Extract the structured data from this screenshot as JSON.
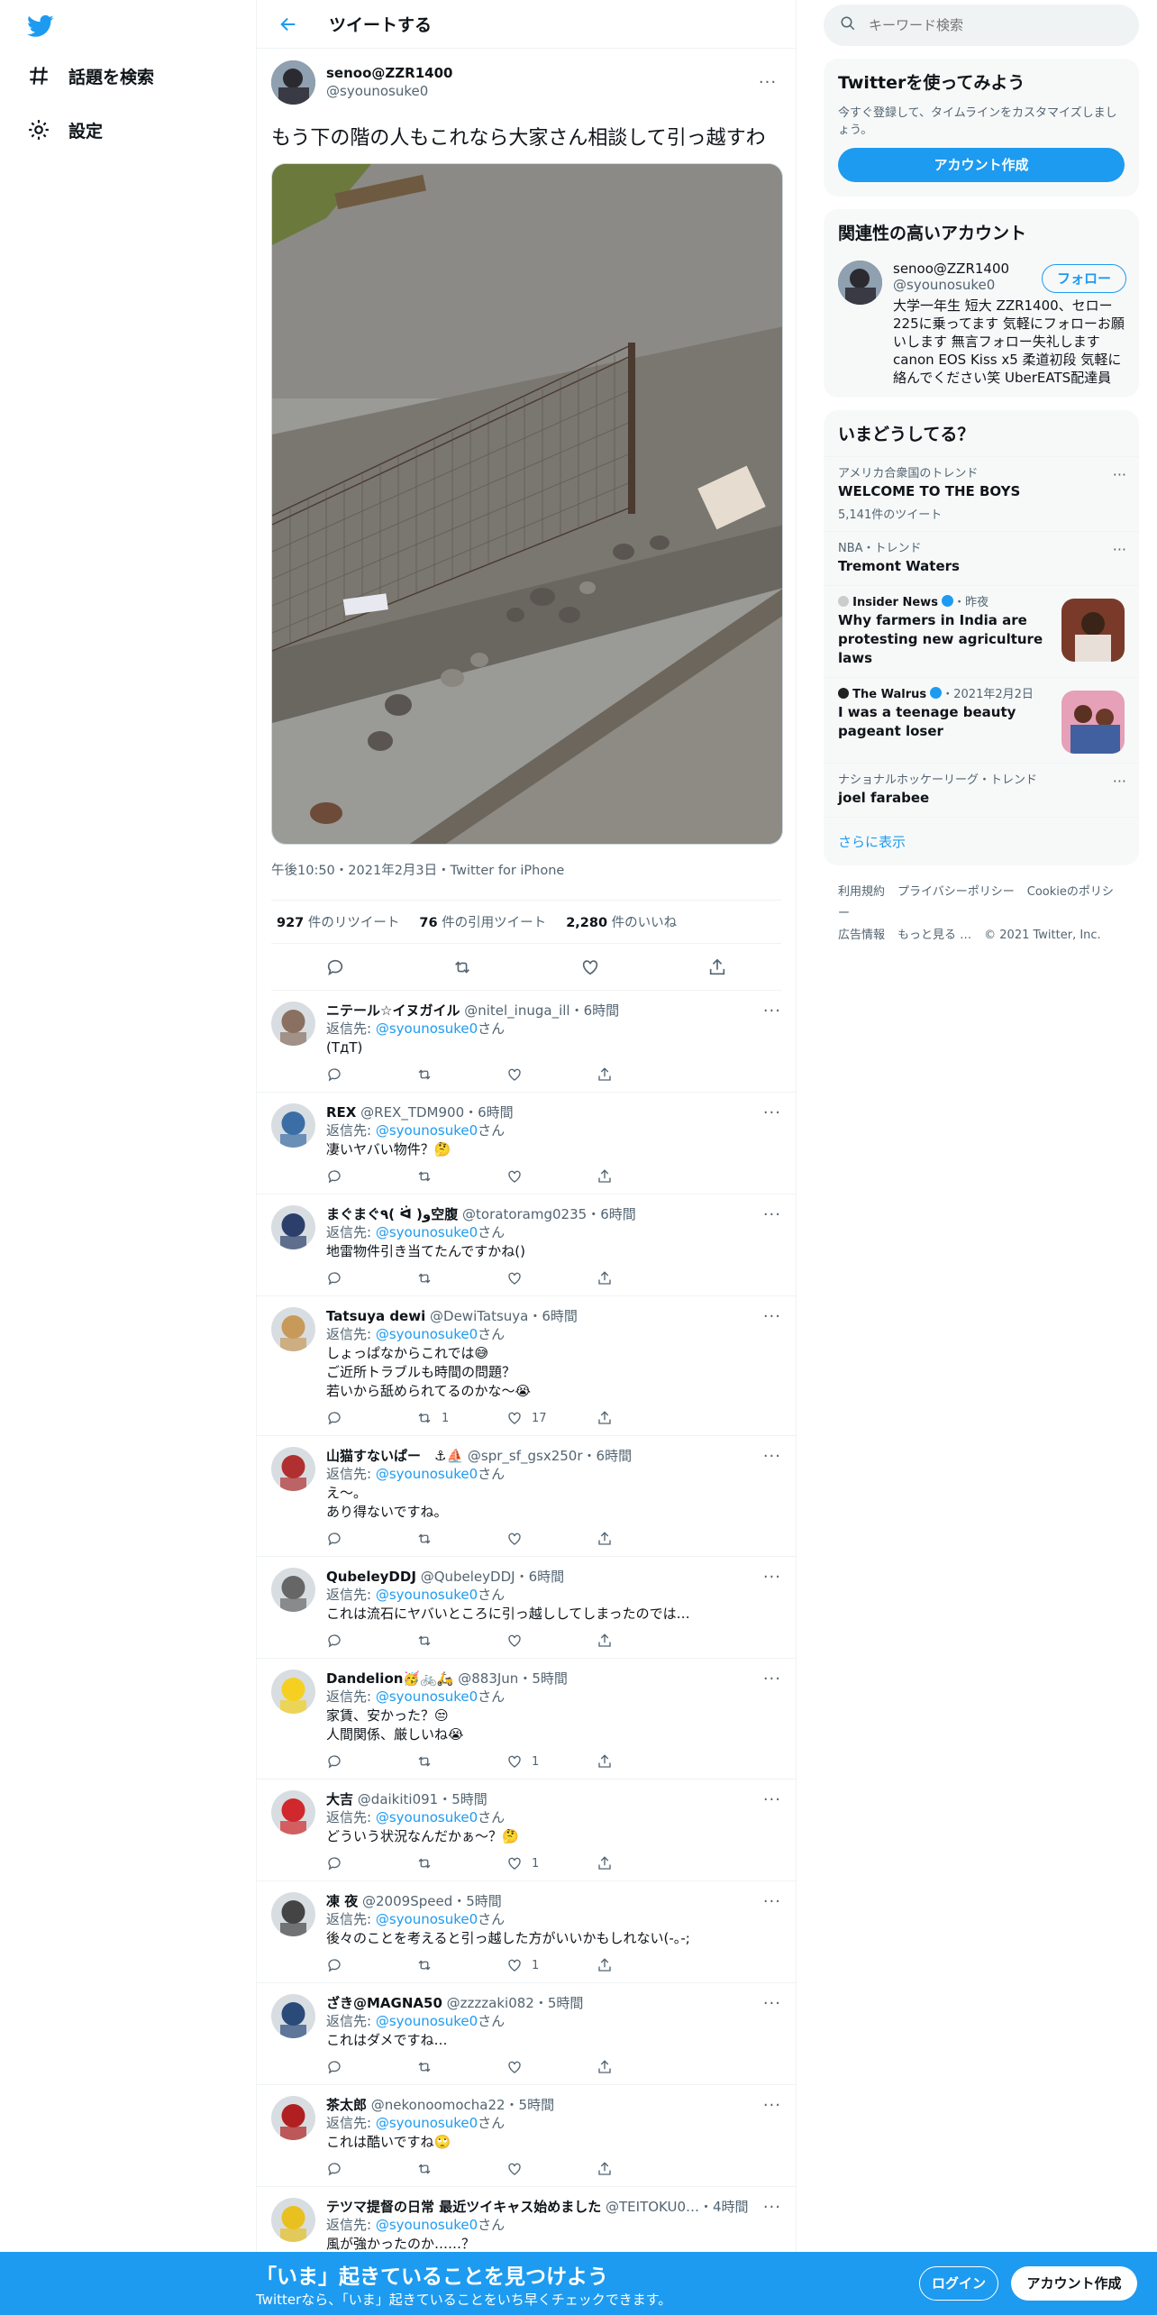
{
  "nav": {
    "explore": "話題を検索",
    "settings": "設定"
  },
  "header": {
    "title": "ツイートする"
  },
  "tweet": {
    "name": "senoo@ZZR1400",
    "handle": "@syounosuke0",
    "text": "もう下の階の人もこれなら大家さん相談して引っ越すわ",
    "meta": "午後10:50・2021年2月3日・Twitter for iPhone",
    "retweets": "927",
    "retweets_label": "件のリツイート",
    "quotes": "76",
    "quotes_label": "件の引用ツイート",
    "likes": "2,280",
    "likes_label": "件のいいね"
  },
  "replies": [
    {
      "name": "ニテール☆イヌガイル",
      "handle": "@nitel_inuga_ill",
      "time": "・6時間",
      "to_label": "返信先: ",
      "to_link": "@syounosuke0",
      "to_suffix": "さん",
      "text": "(TдT)",
      "rt": "",
      "like": "",
      "avatar": "#8a7060"
    },
    {
      "name": "REX",
      "handle": "@REX_TDM900",
      "time": "・6時間",
      "to_label": "返信先: ",
      "to_link": "@syounosuke0",
      "to_suffix": "さん",
      "text": "凄いヤバい物件？🤔",
      "rt": "",
      "like": "",
      "avatar": "#3b6ea5"
    },
    {
      "name": "まぐまぐ٩( ᐛ )و空腹",
      "handle": "@toratoramg0235",
      "time": "・6時間",
      "to_label": "返信先: ",
      "to_link": "@syounosuke0",
      "to_suffix": "さん",
      "text": "地雷物件引き当てたんですかね()",
      "rt": "",
      "like": "",
      "avatar": "#2c3f6a"
    },
    {
      "name": "Tatsuya dewi",
      "handle": "@DewiTatsuya",
      "time": "・6時間",
      "to_label": "返信先: ",
      "to_link": "@syounosuke0",
      "to_suffix": "さん",
      "text": "しょっぱなからこれでは😅\nご近所トラブルも時間の問題？\n若いから舐められてるのかな〜😭",
      "rt": "1",
      "like": "17",
      "avatar": "#c89a5a"
    },
    {
      "name": "山猫すないぱー　⚓⛵",
      "handle": "@spr_sf_gsx250r",
      "time": "・6時間",
      "to_label": "返信先: ",
      "to_link": "@syounosuke0",
      "to_suffix": "さん",
      "text": "え～。\nあり得ないですね。",
      "rt": "",
      "like": "",
      "avatar": "#b03030"
    },
    {
      "name": "QubeleyDDJ",
      "handle": "@QubeleyDDJ",
      "time": "・6時間",
      "to_label": "返信先: ",
      "to_link": "@syounosuke0",
      "to_suffix": "さん",
      "text": "これは流石にヤバいところに引っ越ししてしまったのでは…",
      "rt": "",
      "like": "",
      "avatar": "#666666"
    },
    {
      "name": "Dandelion🥳🚲🛵",
      "handle": "@883Jun",
      "time": "・5時間",
      "to_label": "返信先: ",
      "to_link": "@syounosuke0",
      "to_suffix": "さん",
      "text": "家賃、安かった？😒\n人間関係、厳しいね😭",
      "rt": "",
      "like": "1",
      "avatar": "#f5d020"
    },
    {
      "name": "大吉",
      "handle": "@daikiti091",
      "time": "・5時間",
      "to_label": "返信先: ",
      "to_link": "@syounosuke0",
      "to_suffix": "さん",
      "text": "どういう状況なんだかぁ〜？🤔",
      "rt": "",
      "like": "1",
      "avatar": "#d0282c"
    },
    {
      "name": "凍 夜",
      "handle": "@2009Speed",
      "time": "・5時間",
      "to_label": "返信先: ",
      "to_link": "@syounosuke0",
      "to_suffix": "さん",
      "text": "後々のことを考えると引っ越した方がいいかもしれない(-｡-;",
      "rt": "",
      "like": "1",
      "avatar": "#444444"
    },
    {
      "name": "ざき@MAGNA50",
      "handle": "@zzzzaki082",
      "time": "・5時間",
      "to_label": "返信先: ",
      "to_link": "@syounosuke0",
      "to_suffix": "さん",
      "text": "これはダメですね…",
      "rt": "",
      "like": "",
      "avatar": "#2a4a7a"
    },
    {
      "name": "茶太郎",
      "handle": "@nekonoomocha22",
      "time": "・5時間",
      "to_label": "返信先: ",
      "to_link": "@syounosuke0",
      "to_suffix": "さん",
      "text": "これは酷いですね🙄",
      "rt": "",
      "like": "",
      "avatar": "#b02020"
    },
    {
      "name": "テツマ提督の日常 最近ツイキャス始めました",
      "handle": "@TEITOKU0…",
      "time": "・4時間",
      "to_label": "返信先: ",
      "to_link": "@syounosuke0",
      "to_suffix": "さん",
      "text": "風が強かったのか……？",
      "rt": "",
      "like": "",
      "avatar": "#e8c020"
    }
  ],
  "right": {
    "search_placeholder": "キーワード検索",
    "signup": {
      "title": "Twitterを使ってみよう",
      "sub": "今すぐ登録して、タイムラインをカスタマイズしましょう。",
      "button": "アカウント作成"
    },
    "related": {
      "title": "関連性の高いアカウント",
      "name": "senoo@ZZR1400",
      "handle": "@syounosuke0",
      "follow": "フォロー",
      "bio": "大学一年生 短大 ZZR1400、セロー225に乗ってます 気軽にフォローお願いします 無言フォロー失礼します canon EOS Kiss x5 柔道初段 気軽に絡んでください笑 UberEATS配達員"
    },
    "trends": {
      "title": "いまどうしてる？",
      "items": [
        {
          "ctx": "アメリカ合衆国のトレンド",
          "title": "WELCOME TO THE BOYS",
          "count": "5,141件のツイート"
        },
        {
          "ctx": "NBA・トレンド",
          "title": "Tremont Waters",
          "count": ""
        },
        {
          "source": "Insider News",
          "time": "・昨夜",
          "title": "Why farmers in India are protesting new agriculture laws"
        },
        {
          "source": "The Walrus",
          "time": "・2021年2月2日",
          "title": "I was a teenage beauty pageant loser"
        },
        {
          "ctx": "ナショナルホッケーリーグ・トレンド",
          "title": "joel farabee",
          "count": ""
        }
      ],
      "showmore": "さらに表示"
    },
    "footer": {
      "l1": "利用規約",
      "l2": "プライバシーポリシー",
      "l3": "Cookieのポリシー",
      "l4": "広告情報",
      "l5": "もっと見る …",
      "l6": "© 2021 Twitter, Inc."
    }
  },
  "bottom": {
    "headline": "「いま」起きていることを見つけよう",
    "sub": "Twitterなら、「いま」起きていることをいち早くチェックできます。",
    "login": "ログイン",
    "signup": "アカウント作成"
  },
  "colors": {
    "accent": "#1d9bf0",
    "text": "#0f1419",
    "muted": "#536471"
  }
}
